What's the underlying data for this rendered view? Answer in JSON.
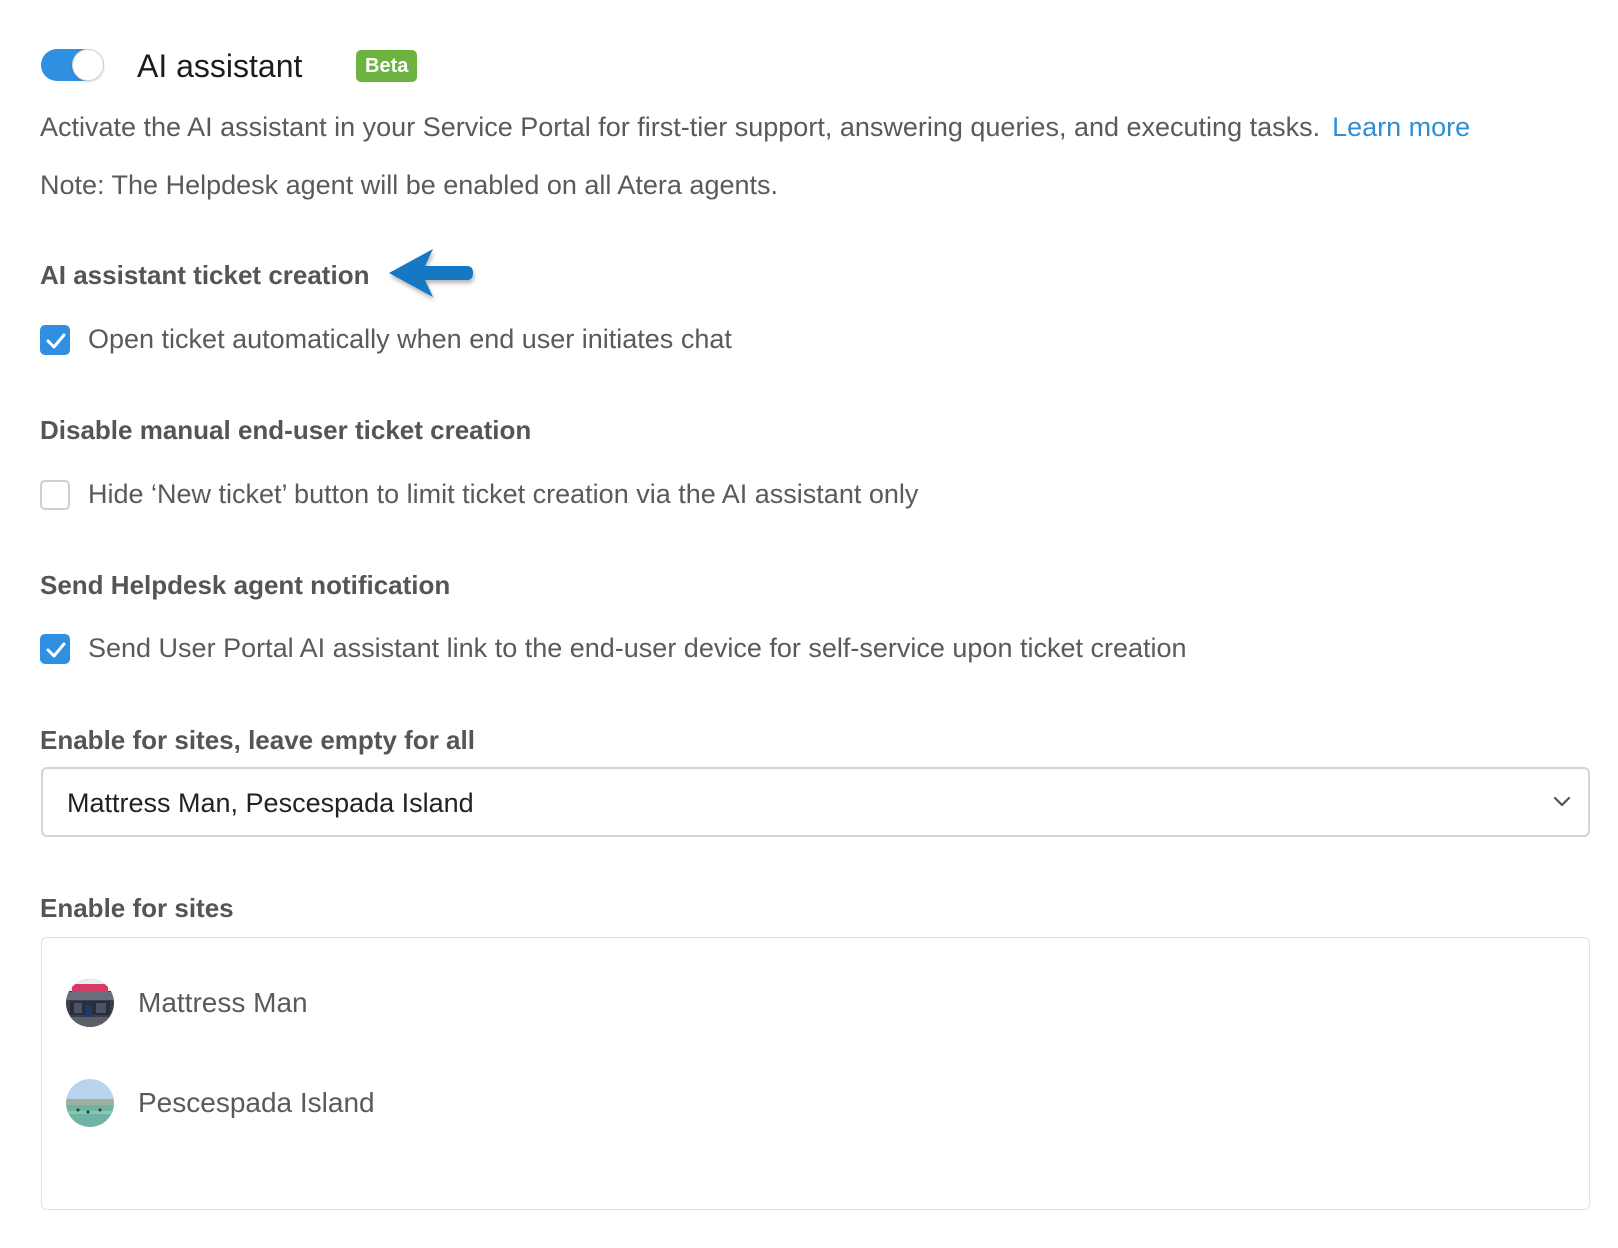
{
  "header": {
    "toggle_state": "on",
    "title": "AI assistant",
    "badge": "Beta"
  },
  "description": {
    "text": "Activate the AI assistant in your Service Portal for first-tier support, answering queries, and executing tasks.",
    "link_label": "Learn more"
  },
  "note": "Note: The Helpdesk agent will be enabled on all Atera agents.",
  "sections": {
    "ticket_creation": {
      "title": "AI assistant ticket creation",
      "option_label": "Open ticket automatically when end user initiates chat",
      "checked": true
    },
    "manual_creation": {
      "title": "Disable manual end-user ticket creation",
      "option_label": "Hide ‘New ticket’ button to limit ticket creation via the AI assistant only",
      "checked": false
    },
    "notification": {
      "title": "Send Helpdesk agent notification",
      "option_label": "Send User Portal AI assistant link to the end-user device for self-service upon ticket creation",
      "checked": true
    }
  },
  "site_select": {
    "label": "Enable for sites, leave empty for all",
    "value": "Mattress Man, Pescespada Island"
  },
  "site_list": {
    "label": "Enable for sites",
    "items": [
      {
        "name": "Mattress Man",
        "avatar": "storefront-photo"
      },
      {
        "name": "Pescespada Island",
        "avatar": "island-photo"
      }
    ]
  },
  "colors": {
    "accent": "#2f8fe0",
    "link": "#2f8fd6",
    "badge": "#6cb43f",
    "arrow": "#1477c2"
  }
}
